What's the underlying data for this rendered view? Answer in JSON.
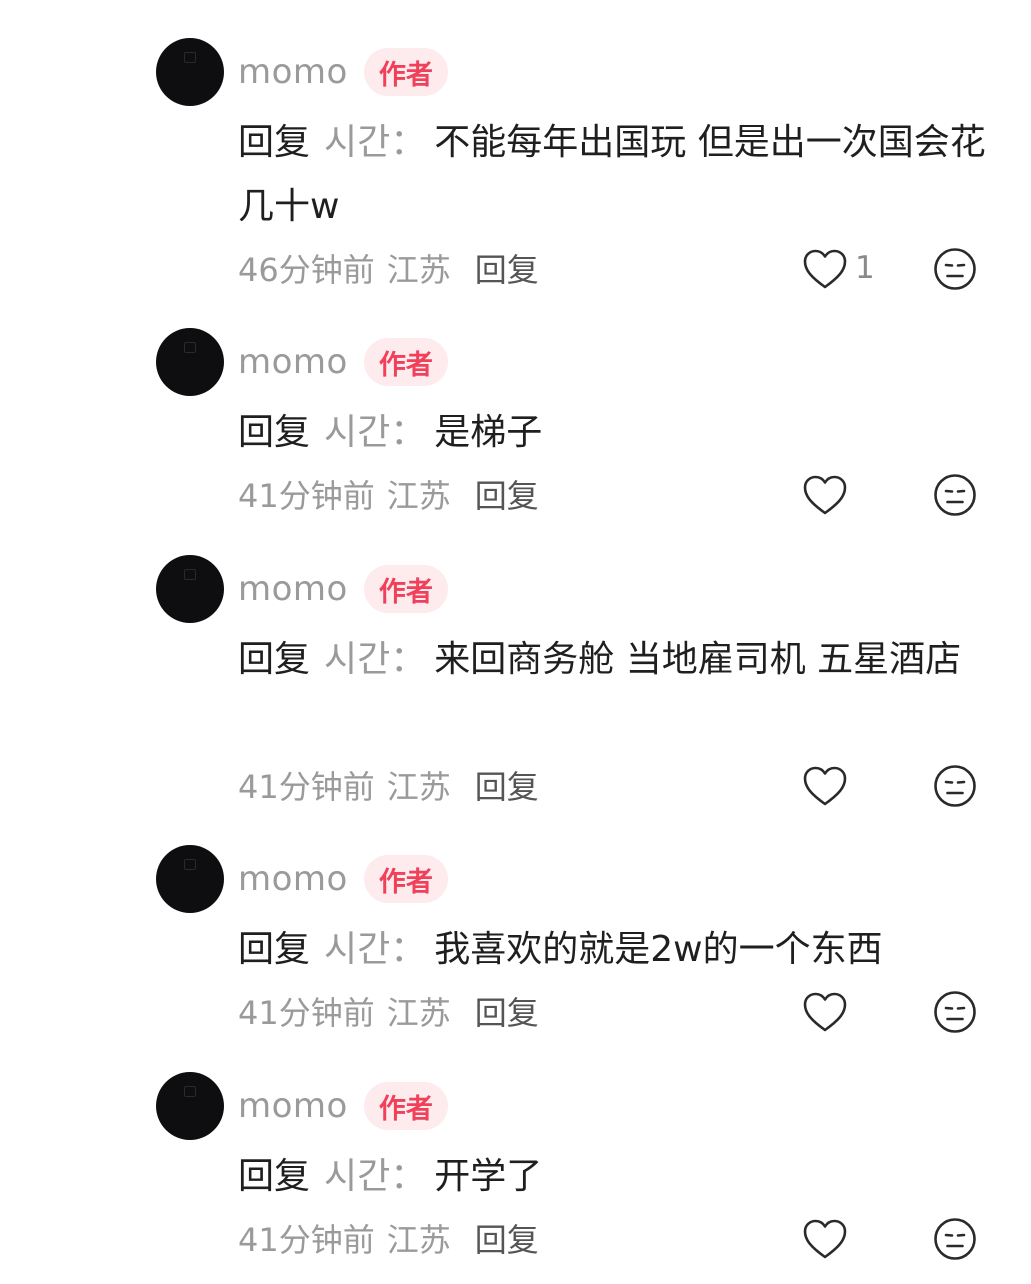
{
  "comments": [
    {
      "username": "momo",
      "badge": "作者",
      "reply_prefix": "回复",
      "reply_target": "시간",
      "reply_colon": "：",
      "text": "不能每年出国玩 但是出一次国会花几十w",
      "time": "46分钟前",
      "region": "江苏",
      "reply_label": "回复",
      "likes": "1",
      "like_icon": "heart-outline-icon",
      "dislike_icon": "neutral-face-icon"
    },
    {
      "username": "momo",
      "badge": "作者",
      "reply_prefix": "回复",
      "reply_target": "시간",
      "reply_colon": "：",
      "text": "是梯子",
      "time": "41分钟前",
      "region": "江苏",
      "reply_label": "回复",
      "likes": "",
      "like_icon": "heart-outline-icon",
      "dislike_icon": "neutral-face-icon"
    },
    {
      "username": "momo",
      "badge": "作者",
      "reply_prefix": "回复",
      "reply_target": "시간",
      "reply_colon": "：",
      "text": "来回商务舱 当地雇司机 五星酒店",
      "time": "41分钟前",
      "region": "江苏",
      "reply_label": "回复",
      "likes": "",
      "like_icon": "heart-outline-icon",
      "dislike_icon": "neutral-face-icon"
    },
    {
      "username": "momo",
      "badge": "作者",
      "reply_prefix": "回复",
      "reply_target": "시간",
      "reply_colon": "：",
      "text": "我喜欢的就是2w的一个东西",
      "time": "41分钟前",
      "region": "江苏",
      "reply_label": "回复",
      "likes": "",
      "like_icon": "heart-outline-icon",
      "dislike_icon": "neutral-face-icon"
    },
    {
      "username": "momo",
      "badge": "作者",
      "reply_prefix": "回复",
      "reply_target": "시간",
      "reply_colon": "：",
      "text": "开学了",
      "time": "41分钟前",
      "region": "江苏",
      "reply_label": "回复",
      "likes": "",
      "like_icon": "heart-outline-icon",
      "dislike_icon": "neutral-face-icon"
    }
  ],
  "colors": {
    "badge_text": "#f0405a",
    "badge_bg": "#fdebed",
    "muted": "#9a9a9a",
    "body_text": "#1f1f1f"
  }
}
